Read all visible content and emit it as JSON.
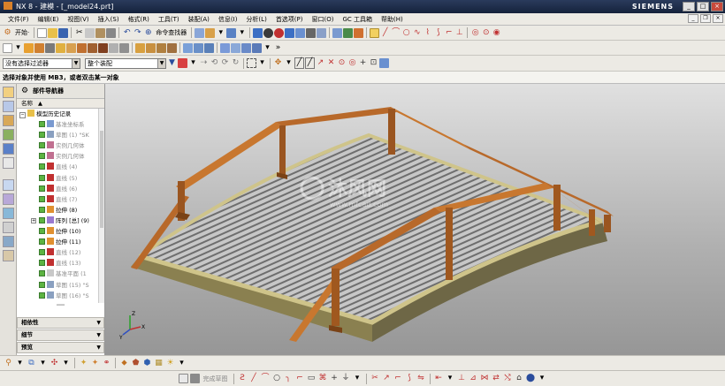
{
  "window": {
    "title": "NX 8 - 建模 - [_model24.prt]",
    "brand": "SIEMENS",
    "min": "_",
    "max": "□",
    "close": "×"
  },
  "menu": [
    "文件(F)",
    "编辑(E)",
    "视图(V)",
    "插入(S)",
    "格式(R)",
    "工具(T)",
    "装配(A)",
    "信息(I)",
    "分析(L)",
    "首选项(P)",
    "窗口(O)",
    "GC 工具箱",
    "帮助(H)"
  ],
  "toolbar1": {
    "start_label": "开始·",
    "cmd_finder": "命令查找器"
  },
  "selection": {
    "filter_value": "没有选择过滤器",
    "scope_value": "整个装配"
  },
  "cue_line": "选择对象并使用 MB3，或者双击某一对象",
  "navigator": {
    "title": "部件导航器",
    "column": "名称",
    "root": "模型历史记录",
    "items": [
      {
        "label": "基准坐标系",
        "grey": true,
        "icon": "datum-csys-icon"
      },
      {
        "label": "草图 (1) \"SK",
        "grey": true,
        "icon": "sketch-icon"
      },
      {
        "label": "实例几何体",
        "grey": true,
        "icon": "instance-icon"
      },
      {
        "label": "实例几何体",
        "grey": true,
        "icon": "instance-icon"
      },
      {
        "label": "直线 (4)",
        "grey": true,
        "icon": "line-icon"
      },
      {
        "label": "直线 (5)",
        "grey": true,
        "icon": "line-icon"
      },
      {
        "label": "直线 (6)",
        "grey": true,
        "icon": "line-icon"
      },
      {
        "label": "直线 (7)",
        "grey": true,
        "icon": "line-icon"
      },
      {
        "label": "拉伸 (8)",
        "grey": false,
        "icon": "extrude-icon"
      },
      {
        "label": "阵列 [总] (9)",
        "grey": false,
        "icon": "pattern-icon",
        "expandable": true
      },
      {
        "label": "拉伸 (10)",
        "grey": false,
        "icon": "extrude-icon"
      },
      {
        "label": "拉伸 (11)",
        "grey": false,
        "icon": "extrude-icon"
      },
      {
        "label": "直线 (12)",
        "grey": true,
        "icon": "line-icon"
      },
      {
        "label": "直线 (13)",
        "grey": true,
        "icon": "line-icon"
      },
      {
        "label": "基准平面 (1",
        "grey": true,
        "icon": "datum-plane-icon"
      },
      {
        "label": "草图 (15) \"S",
        "grey": true,
        "icon": "sketch-icon"
      },
      {
        "label": "草图 (16) \"S",
        "grey": true,
        "icon": "sketch-icon"
      }
    ],
    "panels": [
      "相依性",
      "细节",
      "预览"
    ]
  },
  "sketch_toolbar": {
    "label": "完成草图"
  },
  "watermark": {
    "text": "沐风网",
    "url": "www.mfcad.com"
  },
  "colors": {
    "wood": "#b8692a",
    "wood_dark": "#7a4216",
    "slats": "#aaaaaa",
    "deck_edge": "#cfc48a",
    "deck_side": "#6e6746"
  }
}
